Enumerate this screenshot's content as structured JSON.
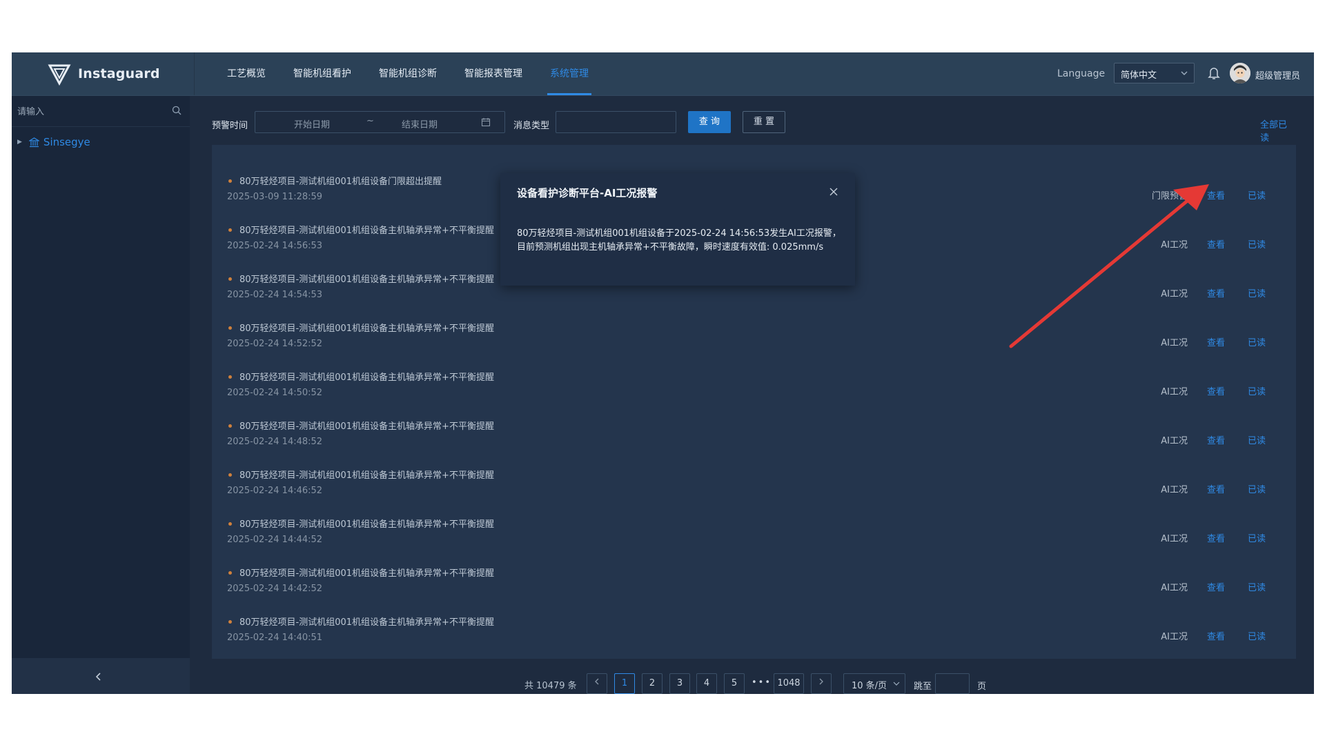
{
  "header": {
    "app_name": "Instaguard",
    "nav": [
      {
        "label": "工艺概览",
        "active": false
      },
      {
        "label": "智能机组看护",
        "active": false
      },
      {
        "label": "智能机组诊断",
        "active": false
      },
      {
        "label": "智能报表管理",
        "active": false
      },
      {
        "label": "系统管理",
        "active": true
      }
    ],
    "language_label": "Language",
    "language_value": "简体中文",
    "user_name": "超级管理员"
  },
  "sidebar": {
    "search_placeholder": "请输入",
    "tree_root": "Sinsegye"
  },
  "filters": {
    "time_label": "预警时间",
    "start_placeholder": "开始日期",
    "separator": "~",
    "end_placeholder": "结束日期",
    "type_label": "消息类型",
    "query_button": "查 询",
    "reset_button": "重 置",
    "mark_all_read": "全部已读"
  },
  "messages": [
    {
      "title": "80万轻烃项目-测试机组001机组设备门限超出提醒",
      "time": "2025-03-09 11:28:59",
      "type": "门限预警",
      "view": "查看",
      "read": "已读"
    },
    {
      "title": "80万轻烃项目-测试机组001机组设备主机轴承异常+不平衡提醒",
      "time": "2025-02-24 14:56:53",
      "type": "AI工况",
      "view": "查看",
      "read": "已读"
    },
    {
      "title": "80万轻烃项目-测试机组001机组设备主机轴承异常+不平衡提醒",
      "time": "2025-02-24 14:54:53",
      "type": "AI工况",
      "view": "查看",
      "read": "已读"
    },
    {
      "title": "80万轻烃项目-测试机组001机组设备主机轴承异常+不平衡提醒",
      "time": "2025-02-24 14:52:52",
      "type": "AI工况",
      "view": "查看",
      "read": "已读"
    },
    {
      "title": "80万轻烃项目-测试机组001机组设备主机轴承异常+不平衡提醒",
      "time": "2025-02-24 14:50:52",
      "type": "AI工况",
      "view": "查看",
      "read": "已读"
    },
    {
      "title": "80万轻烃项目-测试机组001机组设备主机轴承异常+不平衡提醒",
      "time": "2025-02-24 14:48:52",
      "type": "AI工况",
      "view": "查看",
      "read": "已读"
    },
    {
      "title": "80万轻烃项目-测试机组001机组设备主机轴承异常+不平衡提醒",
      "time": "2025-02-24 14:46:52",
      "type": "AI工况",
      "view": "查看",
      "read": "已读"
    },
    {
      "title": "80万轻烃项目-测试机组001机组设备主机轴承异常+不平衡提醒",
      "time": "2025-02-24 14:44:52",
      "type": "AI工况",
      "view": "查看",
      "read": "已读"
    },
    {
      "title": "80万轻烃项目-测试机组001机组设备主机轴承异常+不平衡提醒",
      "time": "2025-02-24 14:42:52",
      "type": "AI工况",
      "view": "查看",
      "read": "已读"
    },
    {
      "title": "80万轻烃项目-测试机组001机组设备主机轴承异常+不平衡提醒",
      "time": "2025-02-24 14:40:51",
      "type": "AI工况",
      "view": "查看",
      "read": "已读"
    }
  ],
  "pagination": {
    "total_text": "共 10479 条",
    "pages": [
      "1",
      "2",
      "3",
      "4",
      "5"
    ],
    "current_page": "1",
    "last_page": "1048",
    "page_size": "10 条/页",
    "jump_label": "跳至",
    "page_suffix": "页"
  },
  "dialog": {
    "title": "设备看护诊断平台-AI工况报警",
    "body": "80万轻烃项目-测试机组001机组设备于2025-02-24 14:56:53发生AI工况报警，目前预测机组出现主机轴承异常+不平衡故障，瞬时速度有效值: 0.025mm/s"
  },
  "colors": {
    "accent": "#2f8ae5",
    "header_bg": "#2b4157",
    "content_bg": "#1e2b3f",
    "arrow": "#e53935"
  }
}
